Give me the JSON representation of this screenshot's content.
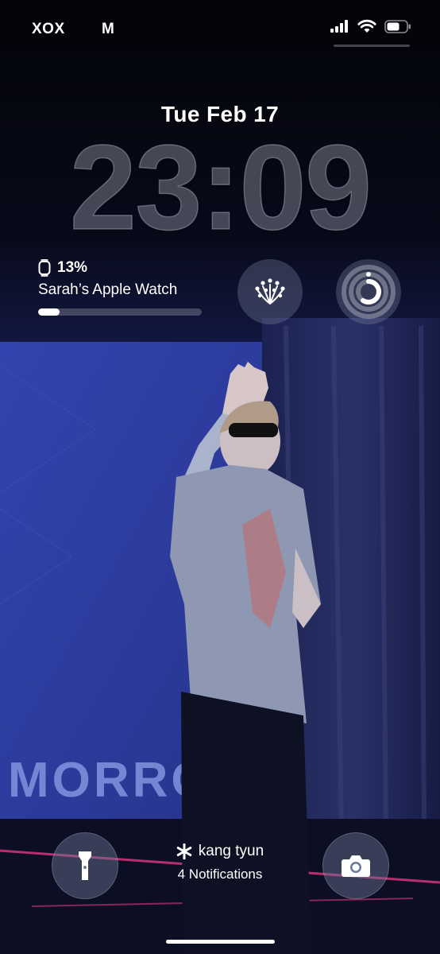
{
  "status_bar": {
    "carrier_left": "XOX",
    "carrier_mid": "M",
    "signal_icon": "cellular-signal-icon",
    "wifi_icon": "wifi-icon",
    "battery_icon": "battery-icon"
  },
  "lock_screen": {
    "date": "Tue Feb 17",
    "time": "23:09"
  },
  "widgets": {
    "battery": {
      "icon": "apple-watch-icon",
      "percent_label": "13%",
      "level": 0.13,
      "device_name": "Sarah’s Apple Watch"
    },
    "app_widget_icon": "fireworks-icon",
    "activity_widget_icon": "activity-rings-icon"
  },
  "notifications": {
    "icon": "asterisk-icon",
    "sender": "kang tyun",
    "count_label": "4 Notifications"
  },
  "controls": {
    "flashlight_icon": "flashlight-icon",
    "camera_icon": "camera-icon"
  },
  "wallpaper": {
    "stage_text": "MORRO",
    "colors": {
      "sky": "#05070f",
      "stage_blue": "#2b3a9a",
      "curtain": "#1c2352"
    }
  }
}
